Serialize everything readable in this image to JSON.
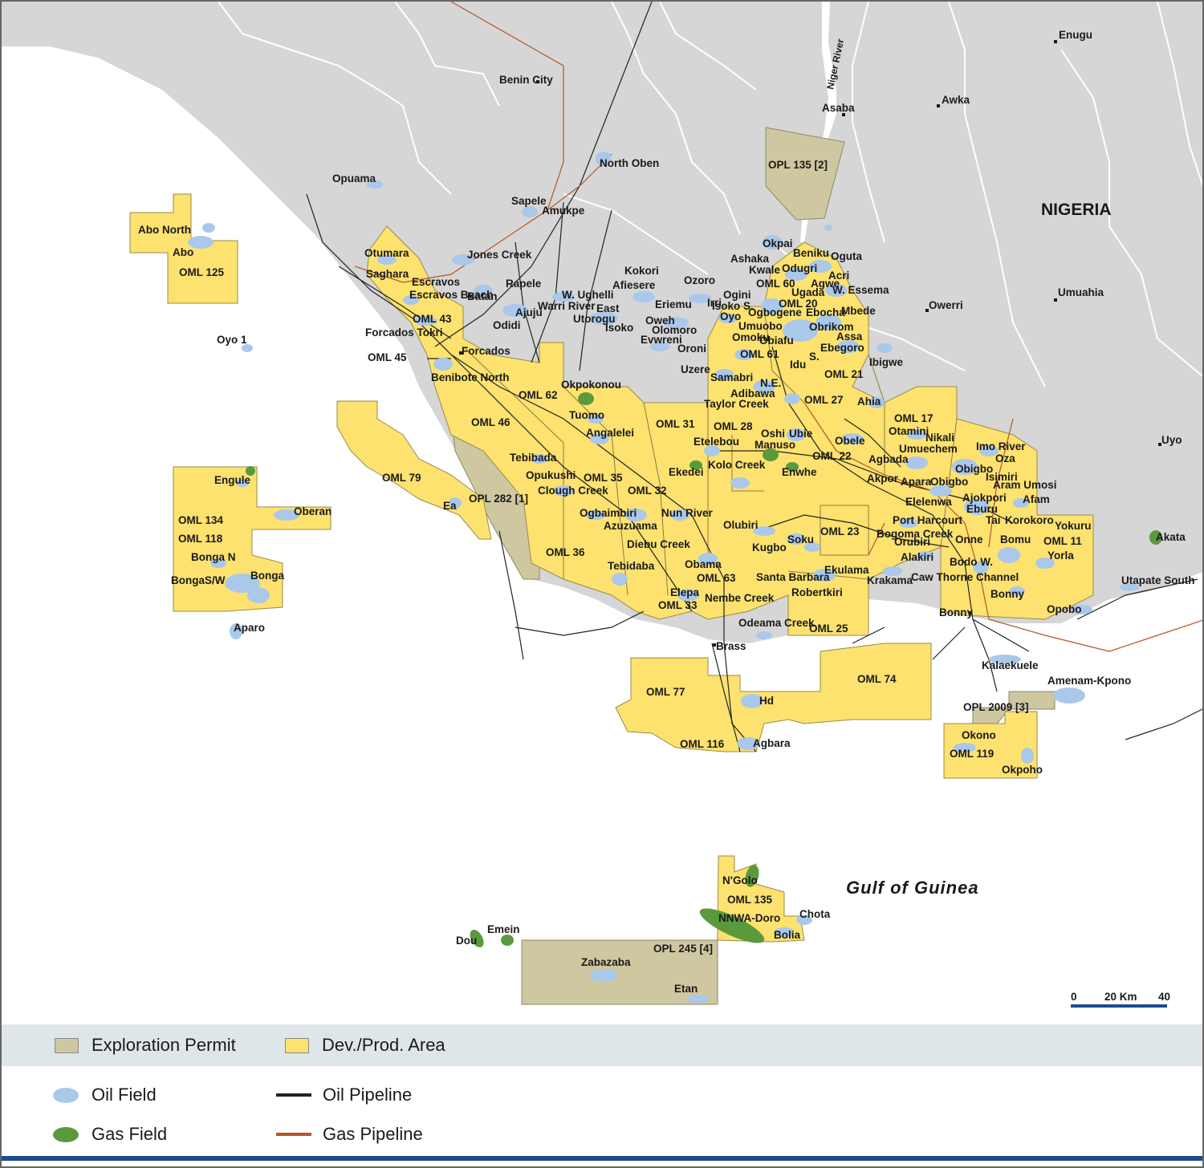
{
  "map": {
    "country_label": "NIGERIA",
    "sea_label": "Gulf of Guinea",
    "river_label": "Niger River",
    "cities": [
      {
        "name": "Enugu"
      },
      {
        "name": "Awka"
      },
      {
        "name": "Asaba"
      },
      {
        "name": "Benin City"
      },
      {
        "name": "Umuahia"
      },
      {
        "name": "Owerri"
      },
      {
        "name": "Uyo"
      },
      {
        "name": "Port Harcourt"
      },
      {
        "name": "Forcados"
      },
      {
        "name": "Bonny"
      },
      {
        "name": "Brass"
      }
    ],
    "blocks": [
      "OML 125",
      "OML 43",
      "OML 45",
      "OML 46",
      "OML 62",
      "OML 31",
      "OML 28",
      "OML 17",
      "OML 22",
      "OML 35",
      "OML 32",
      "OML 36",
      "OML 79",
      "OML 134",
      "OML 118",
      "OML 60",
      "OML 20",
      "OML 61",
      "OML 21",
      "OML 27",
      "OML 23",
      "OML 63",
      "OML 33",
      "OML 25",
      "OML 11",
      "OML 77",
      "OML 74",
      "OML 116",
      "OML 119",
      "OML 135",
      "OPL 135 [2]",
      "OPL 282 [1]",
      "OPL 2009 [3]",
      "OPL 245 [4]"
    ],
    "fields": [
      "Abo North",
      "Abo",
      "Oyo 1",
      "Opuama",
      "North Oben",
      "Sapele",
      "Amukpe",
      "Jones Creek",
      "Otumara",
      "Saghara",
      "Escravos",
      "Escravos Beach",
      "Forcados Tokri",
      "Benibote North",
      "Batan",
      "Ajuju",
      "Odidi",
      "Rapele",
      "W. Ughelli",
      "Warri River",
      "East",
      "Utorogu",
      "Afiesere",
      "Kokori",
      "Eriemu",
      "Isoko",
      "Oweh",
      "Olomoro",
      "Evwreni",
      "Uzere",
      "Oroni",
      "Ozoro",
      "Ogini",
      "Irri",
      "Isoko S.",
      "Oyo",
      "Ashaka",
      "Kwale",
      "Okpai",
      "Beniku",
      "Oguta",
      "Odugri",
      "Acri",
      "Ugada",
      "Agwe",
      "W. Essema",
      "Ogbogene",
      "Ebocha",
      "Mbede",
      "Umuobo",
      "Obrikom",
      "Omoku",
      "Obiafu",
      "Assa",
      "Ebegoro",
      "Ibigwe",
      "Idu",
      "S.",
      "Samabri",
      "Adibawa",
      "N.E.",
      "Taylor Creek",
      "Ahia",
      "Okpokonou",
      "Tuomo",
      "Angalelei",
      "Etelebou",
      "Oshi",
      "Ubie",
      "Manuso",
      "Obele",
      "Otamini",
      "Nikali",
      "Umuechem",
      "Imo River",
      "Oza",
      "Agbada",
      "Obigbo",
      "Isimiri",
      "Aram Umosi",
      "Akpor",
      "Apara",
      "Obigbo",
      "Afam",
      "Elelenwa",
      "Ajokpori",
      "Eburu",
      "Tai",
      "Korokoro",
      "Yokuru",
      "Onne",
      "Bomu",
      "Yorla",
      "Bodo W.",
      "Bonny",
      "Opobo",
      "Utapate South",
      "Akata",
      "Tebibada",
      "Opukushi",
      "Clough Creek",
      "Ogbaimbiri",
      "Azuzuama",
      "Nun River",
      "Ekedei",
      "Kolo Creek",
      "Enwhe",
      "Olubiri",
      "Kugbo",
      "Soku",
      "Bogoma Creek",
      "Orubiri",
      "Alakiri",
      "Diebu Creek",
      "Tebidaba",
      "Obama",
      "Elepa",
      "Nembe Creek",
      "Santa Barbara",
      "Robertkiri",
      "Ekulama",
      "Krakama",
      "Caw Thorne Channel",
      "Odeama Creek",
      "Engule",
      "Oberan",
      "Bonga N",
      "Bonga",
      "BongaS/W",
      "Aparo",
      "Ea",
      "Hd",
      "Agbara",
      "Kalaekuele",
      "Amenam-Kpono",
      "Okono",
      "Okpoho",
      "N'Golo",
      "NNWA-Doro",
      "Chota",
      "Bolia",
      "Emein",
      "Dou",
      "Zabazaba",
      "Etan"
    ],
    "colors": {
      "land": "#d6d6d6",
      "sea": "#ffffff",
      "dev_area": "#fde26f",
      "exploration": "#cfc7a0",
      "oil_field": "#a9c8ea",
      "gas_field": "#5b9a3c",
      "oil_pipeline": "#222222",
      "gas_pipeline": "#b2562a",
      "border": "#ffffff"
    }
  },
  "scale": {
    "tick_0": "0",
    "tick_20": "20 Km",
    "tick_40": "40"
  },
  "legend": {
    "exploration_permit": "Exploration Permit",
    "dev_prod_area": "Dev./Prod. Area",
    "oil_field": "Oil Field",
    "gas_field": "Gas Field",
    "oil_pipeline": "Oil Pipeline",
    "gas_pipeline": "Gas Pipeline"
  }
}
